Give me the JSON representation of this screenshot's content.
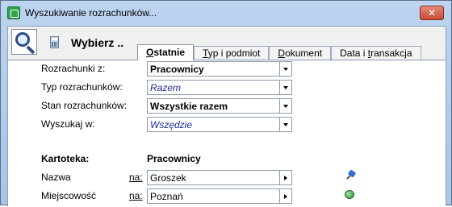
{
  "window": {
    "title": "Wyszukiwanie rozrachunków...",
    "close_symbol": "✕"
  },
  "header": {
    "title": "Wybierz .."
  },
  "tabs": [
    {
      "pre": "",
      "ul": "O",
      "post": "statnie",
      "active": true
    },
    {
      "pre": "",
      "ul": "T",
      "post": "yp i podmiot",
      "active": false
    },
    {
      "pre": "",
      "ul": "D",
      "post": "okument",
      "active": false
    },
    {
      "pre": "Data i ",
      "ul": "t",
      "post": "ransakcja",
      "active": false
    }
  ],
  "form": {
    "rozrachunki": {
      "label": "Rozrachunki z:",
      "value": "Pracownicy"
    },
    "typ": {
      "label": "Typ rozrachunków:",
      "value": "Razem"
    },
    "stan": {
      "label": "Stan rozrachunków:",
      "value": "Wszystkie razem"
    },
    "wyszukaj": {
      "label": "Wyszukaj w:",
      "value": "Wszędzie"
    }
  },
  "kartoteka": {
    "label": "Kartoteka:",
    "value": "Pracownicy",
    "nazwa": {
      "label": "Nazwa",
      "na": "na:",
      "value": "Groszek"
    },
    "miejscowosc": {
      "label": "Miejscowość",
      "na": "na:",
      "value": "Poznań"
    }
  },
  "icons": {
    "app": "app-icon",
    "search": "magnifier-icon",
    "calc": "calculator-icon",
    "pin": "pushpin-icon",
    "globe": "globe-icon"
  }
}
